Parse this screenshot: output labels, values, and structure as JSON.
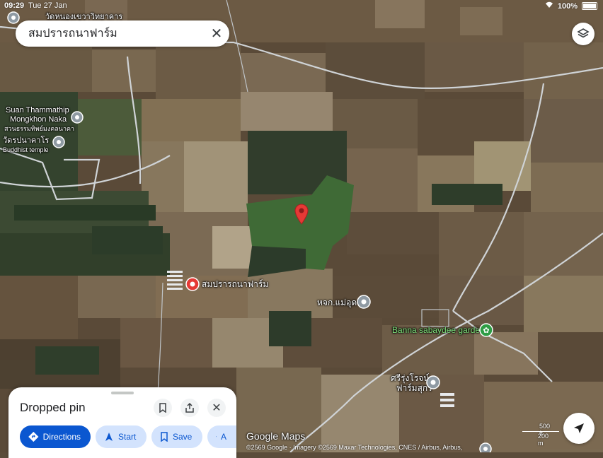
{
  "status": {
    "time": "09:29",
    "date": "Tue 27 Jan",
    "battery": "100%"
  },
  "search": {
    "query": "สมปรารถนาฟาร์ม",
    "clear_icon": "close-icon"
  },
  "map": {
    "labels": {
      "top_partial": "วัดหนองเขวาวิทยาคาร",
      "poi1_en": "Suan Thammathip",
      "poi1_en2": "Mongkhon Naka",
      "poi1_th": "สวนธรรมทิพย์มงคลนาคา",
      "poi2_th": "วัดรปนาคาโร",
      "poi2_type": "Buddhist temple",
      "farm": "สมปรารถนาฟาร์ม",
      "shop": "หจก.แม่อุดร",
      "garden": "Banna sabaydee garden",
      "pig_farm_l1": "ศรีรุ่งโรจน์",
      "pig_farm_l2": "ฟาร์มสุกร"
    },
    "colors": {
      "pin": "#e53935",
      "road": "#cfd3d6",
      "garden": "#7ee07a"
    }
  },
  "sheet": {
    "title": "Dropped pin",
    "buttons": {
      "directions": "Directions",
      "start": "Start",
      "save": "Save",
      "more": "A"
    }
  },
  "footer": {
    "brand": "Google Maps",
    "copyright": "©2569 Google · Imagery ©2569 Maxar Technologies, CNES / Airbus, Airbus,",
    "scale_ft": "500 ft",
    "scale_m": "200 m"
  }
}
